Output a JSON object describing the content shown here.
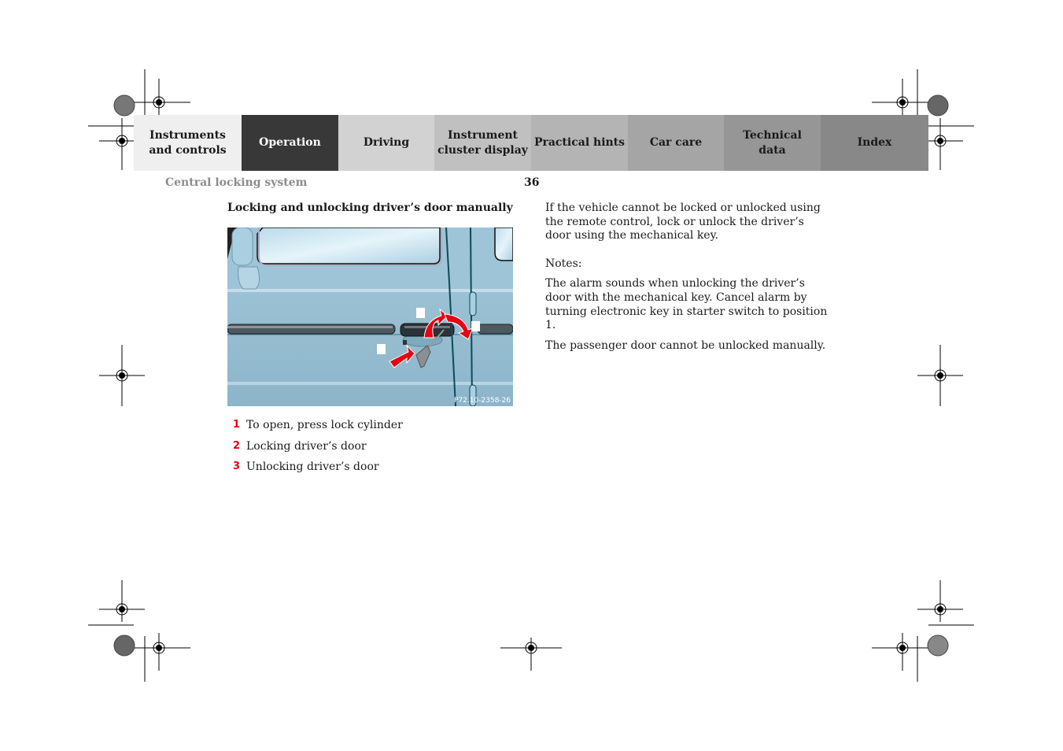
{
  "nav": {
    "tabs": [
      {
        "label": "Instruments\nand controls",
        "active": false
      },
      {
        "label": "Operation",
        "active": true
      },
      {
        "label": "Driving",
        "active": false
      },
      {
        "label": "Instrument\ncluster display",
        "active": false
      },
      {
        "label": "Practical hints",
        "active": false
      },
      {
        "label": "Car care",
        "active": false
      },
      {
        "label": "Technical\ndata",
        "active": false
      },
      {
        "label": "Index",
        "active": false
      }
    ]
  },
  "header": {
    "section_title": "Central locking system",
    "page_number": "36"
  },
  "content": {
    "heading": "Locking and unlocking driver’s door manually",
    "figure": {
      "code": "P72.10-2358-26",
      "description": "Driver's door with lock cylinder, key and red arrows"
    },
    "legend": [
      {
        "num": "1",
        "text": "To open, press lock cylinder"
      },
      {
        "num": "2",
        "text": "Locking driver’s door"
      },
      {
        "num": "3",
        "text": "Unlocking driver’s door"
      }
    ],
    "right": {
      "intro": "If the vehicle cannot be locked or unlocked using the remote control, lock or unlock the driver’s door using the mechanical key.",
      "notes_label": "Notes:",
      "note1": "The alarm sounds when unlocking the driver’s door with the mechanical key. Cancel alarm by turning electronic key in starter switch to position 1.",
      "note2": "The passenger door cannot be unlocked manually."
    }
  },
  "colors": {
    "accent_red": "#e30613",
    "active_tab": "#383838"
  }
}
